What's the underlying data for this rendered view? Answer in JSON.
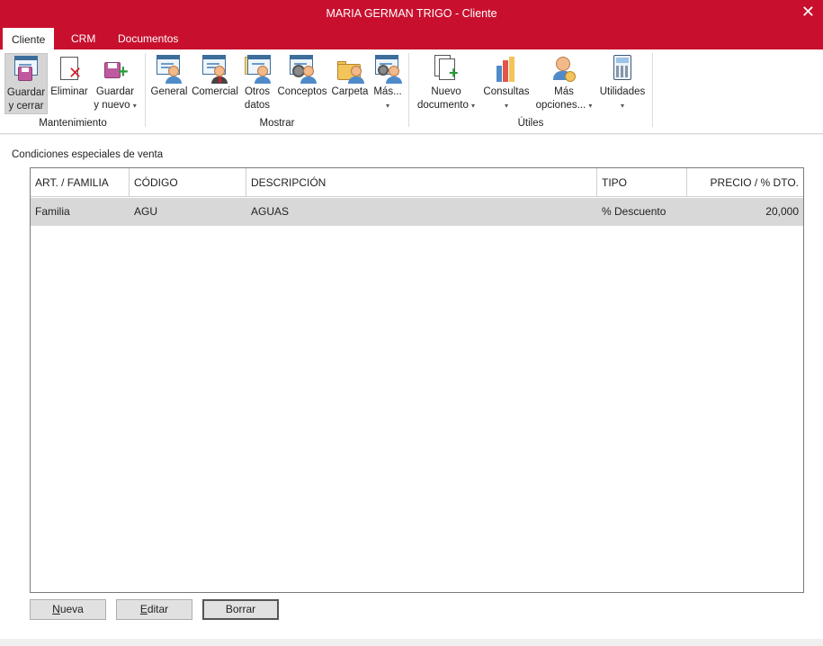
{
  "window": {
    "title": "MARIA GERMAN TRIGO - Cliente",
    "close_glyph": "✕"
  },
  "tabs": [
    {
      "label": "Cliente",
      "active": true
    },
    {
      "label": "CRM",
      "active": false
    },
    {
      "label": "Documentos",
      "active": false
    }
  ],
  "ribbon": {
    "groups": {
      "mantenimiento": "Mantenimiento",
      "mostrar": "Mostrar",
      "utiles": "Útiles"
    },
    "mantenimiento": {
      "guardar_cerrar": [
        "Guardar",
        "y cerrar"
      ],
      "eliminar": "Eliminar",
      "guardar_nuevo": [
        "Guardar",
        "y nuevo"
      ]
    },
    "mostrar": {
      "general": "General",
      "comercial": "Comercial",
      "otros_datos": [
        "Otros",
        "datos"
      ],
      "conceptos": "Conceptos",
      "carpeta": "Carpeta",
      "mas": "Más..."
    },
    "utiles": {
      "nuevo_documento": [
        "Nuevo",
        "documento"
      ],
      "consultas": "Consultas",
      "mas_opciones": [
        "Más",
        "opciones..."
      ],
      "utilidades": "Utilidades"
    },
    "caret": "▾"
  },
  "section": {
    "title": "Condiciones especiales de venta"
  },
  "table": {
    "columns": [
      "ART. / FAMILIA",
      "CÓDIGO",
      "DESCRIPCIÓN",
      "TIPO",
      "PRECIO / % DTO."
    ],
    "rows": [
      [
        "Familia",
        "AGU",
        "AGUAS",
        "% Descuento",
        "20,000"
      ]
    ]
  },
  "buttons": {
    "nueva": {
      "mnemonic": "N",
      "rest": "ueva"
    },
    "editar": {
      "mnemonic": "E",
      "rest": "ditar"
    },
    "borrar": {
      "label": "Borrar"
    }
  },
  "colors": {
    "brand": "#c8102e",
    "selected_row": "#d8d8d8"
  },
  "icons": [
    "close-icon",
    "save-close-icon",
    "delete-icon",
    "save-new-icon",
    "general-icon",
    "commercial-icon",
    "other-data-icon",
    "concepts-icon",
    "folder-icon",
    "more-icon",
    "new-document-icon",
    "chart-icon",
    "more-options-icon",
    "calculator-icon"
  ]
}
